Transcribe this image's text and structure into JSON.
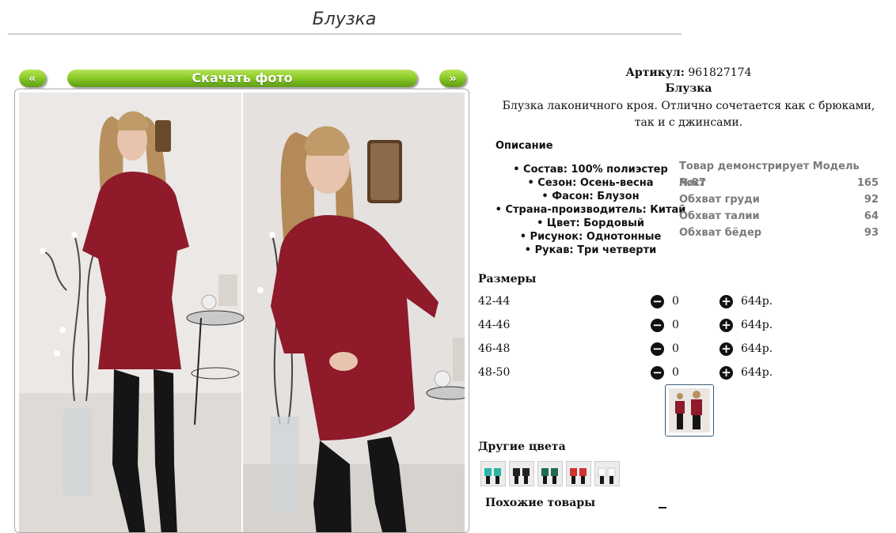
{
  "page": {
    "title": "Блузка"
  },
  "gallery": {
    "prev_label": "«",
    "download_label": "Скачать фото",
    "next_label": "»"
  },
  "product": {
    "article_label": "Артикул:",
    "article_value": "961827174",
    "name": "Блузка",
    "description": "Блузка лаконичного кроя. Отлично сочетается как с брюками, так и с джинсами."
  },
  "description_section": {
    "heading": "Описание",
    "properties": [
      "Состав: 100% полиэстер",
      "Сезон: Осень-весна",
      "Фасон: Блузон",
      "Страна-производитель: Китай",
      "Цвет: Бордовый",
      "Рисунок: Однотонные",
      "Рукав: Три четверти"
    ]
  },
  "model": {
    "title": "Товар демонстрирует Модель №87",
    "rows": [
      {
        "label": "Рост",
        "value": "165"
      },
      {
        "label": "Обхват груди",
        "value": "92"
      },
      {
        "label": "Обхват талии",
        "value": "64"
      },
      {
        "label": "Обхват бёдер",
        "value": "93"
      }
    ]
  },
  "sizes": {
    "heading": "Размеры",
    "items": [
      {
        "size": "42-44",
        "qty": "0",
        "price": "644р."
      },
      {
        "size": "44-46",
        "qty": "0",
        "price": "644р."
      },
      {
        "size": "46-48",
        "qty": "0",
        "price": "644р."
      },
      {
        "size": "48-50",
        "qty": "0",
        "price": "644р."
      }
    ],
    "minus_glyph": "−",
    "plus_glyph": "+"
  },
  "other_colors": {
    "heading": "Другие цвета",
    "colors": [
      "#2bb5a5",
      "#222222",
      "#1f6b55",
      "#d33030",
      "#f4f4f4"
    ]
  },
  "similar": {
    "heading": "Похожие товары"
  },
  "colors": {
    "blouse": "#8e1a2a",
    "button_green": "#7fc21f"
  }
}
